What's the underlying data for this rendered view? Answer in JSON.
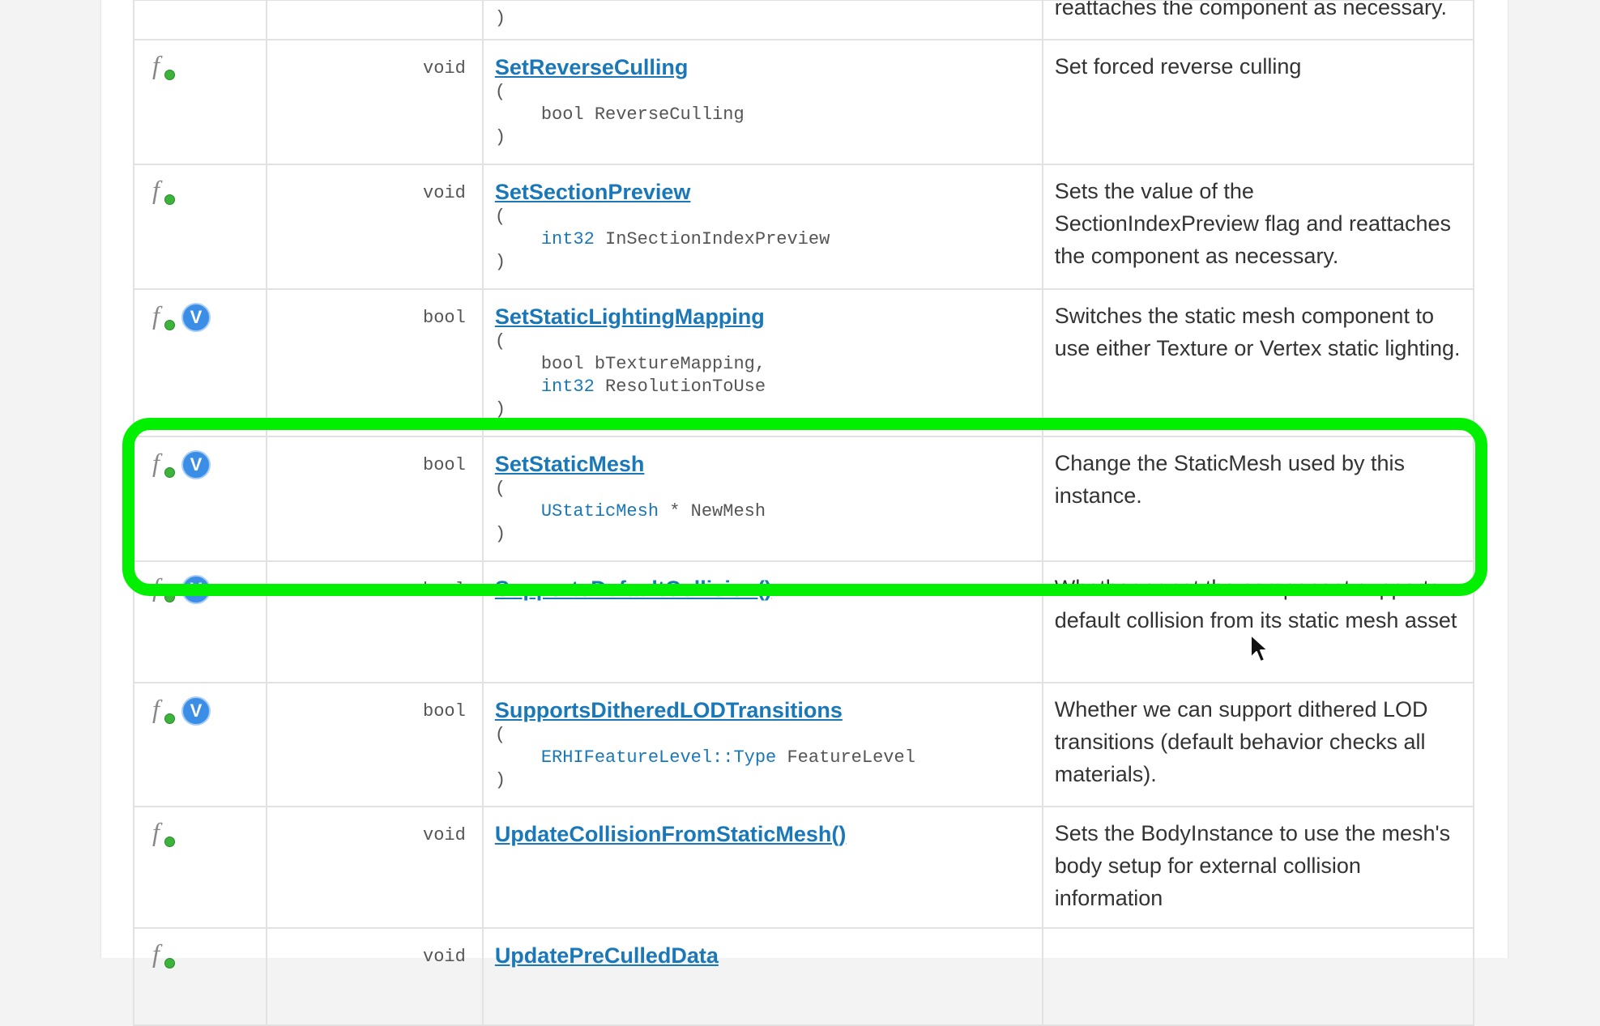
{
  "rows": [
    {
      "return_type": "",
      "name": "",
      "params": [],
      "close_paren": ")",
      "description": "reattaches the component as necessary.",
      "virtual": false
    },
    {
      "return_type": "void",
      "name": "SetReverseCulling",
      "open_paren": "(",
      "params": [
        {
          "type": "",
          "name": "bool ReverseCulling"
        }
      ],
      "close_paren": ")",
      "description": "Set forced reverse culling",
      "virtual": false
    },
    {
      "return_type": "void",
      "name": "SetSectionPreview",
      "open_paren": "(",
      "params": [
        {
          "type": "int32",
          "name": " InSectionIndexPreview"
        }
      ],
      "close_paren": ")",
      "description": "Sets the value of the SectionIndexPreview flag and reattaches the component as necessary.",
      "virtual": false
    },
    {
      "return_type": "bool",
      "name": "SetStaticLightingMapping",
      "open_paren": "(",
      "params": [
        {
          "type": "",
          "name": "bool bTextureMapping,"
        },
        {
          "type": "int32",
          "name": " ResolutionToUse"
        }
      ],
      "close_paren": ")",
      "description": "Switches the static mesh component to use either Texture or Vertex static lighting.",
      "virtual": true
    },
    {
      "return_type": "bool",
      "name": "SetStaticMesh",
      "open_paren": "(",
      "params": [
        {
          "type": "UStaticMesh",
          "name": " * NewMesh"
        }
      ],
      "close_paren": ")",
      "description": "Change the StaticMesh used by this instance.",
      "virtual": true
    },
    {
      "return_type": "bool",
      "name": "SupportsDefaultCollision()",
      "params": [],
      "description": "Whether or not the component supports default collision from its static mesh asset",
      "virtual": true
    },
    {
      "return_type": "bool",
      "name": "SupportsDitheredLODTransitions",
      "open_paren": "(",
      "params": [
        {
          "type": "ERHIFeatureLevel::Type",
          "name": " FeatureLevel"
        }
      ],
      "close_paren": ")",
      "description": "Whether we can support dithered LOD transitions (default behavior checks all materials).",
      "virtual": true
    },
    {
      "return_type": "void",
      "name": "UpdateCollisionFromStaticMesh()",
      "params": [],
      "description": "Sets the BodyInstance to use the mesh's body setup for external collision information",
      "virtual": false
    },
    {
      "return_type": "void",
      "name": "UpdatePreCulledData",
      "params": [],
      "description": "",
      "virtual": false
    }
  ],
  "icons": {
    "function": "function-icon",
    "virtual": "virtual-icon",
    "virtual_letter": "V"
  },
  "colors": {
    "link": "#1a78b8",
    "highlight": "#00f000",
    "virtual_badge": "#3a8ee6"
  }
}
